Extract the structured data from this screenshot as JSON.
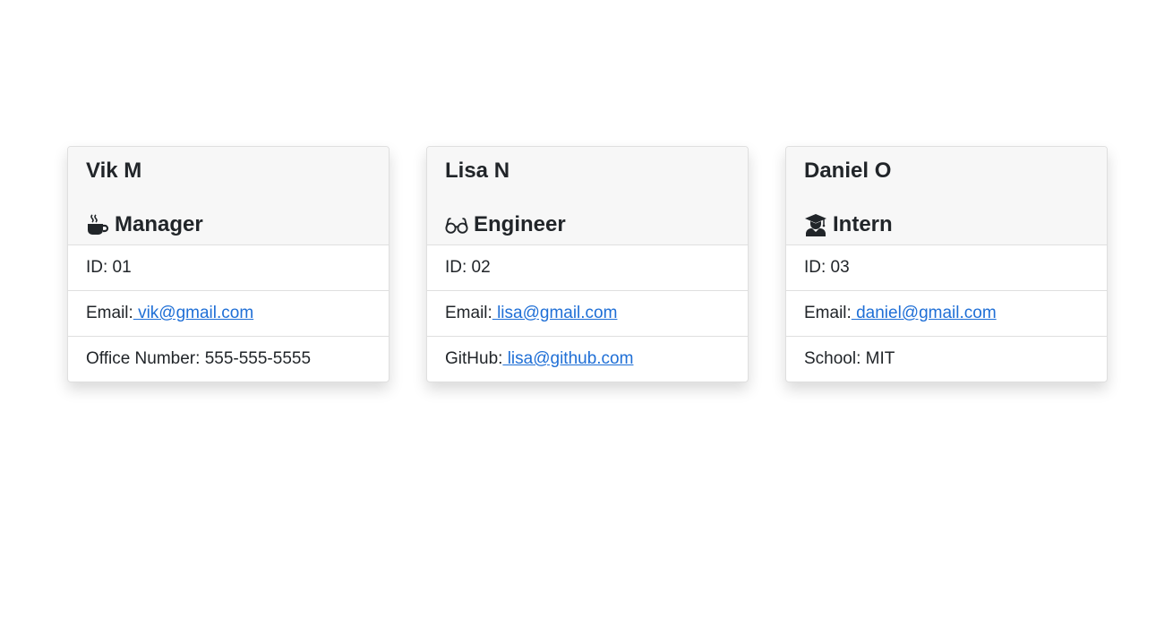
{
  "employees": [
    {
      "name": "Vik M",
      "role": "Manager",
      "role_icon": "coffee-icon",
      "id_text": "ID: 01",
      "email_label": "Email:",
      "email_value": " vik@gmail.com",
      "extra_label": "Office Number: 555-555-5555",
      "extra_value": ""
    },
    {
      "name": "Lisa N",
      "role": "Engineer",
      "role_icon": "glasses-icon",
      "id_text": "ID: 02",
      "email_label": "Email:",
      "email_value": " lisa@gmail.com",
      "extra_label": "GitHub:",
      "extra_value": " lisa@github.com"
    },
    {
      "name": "Daniel O",
      "role": "Intern",
      "role_icon": "graduate-icon",
      "id_text": "ID: 03",
      "email_label": "Email:",
      "email_value": " daniel@gmail.com",
      "extra_label": "School: MIT",
      "extra_value": ""
    }
  ],
  "colors": {
    "link": "#1f6fd6",
    "header_bg": "#f7f7f7",
    "border": "#dfdfdf",
    "text": "#212529"
  }
}
